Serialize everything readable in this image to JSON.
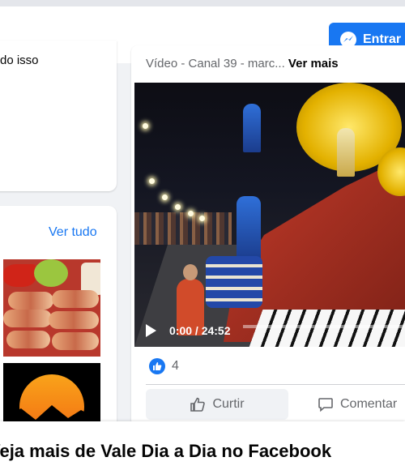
{
  "header": {
    "enter_label": "Entrar",
    "enter_icon": "messenger-icon",
    "accent": "#1877f2"
  },
  "left_top": {
    "snippet": "do isso"
  },
  "photos": {
    "see_all": "Ver tudo"
  },
  "post": {
    "caption": "Vídeo - Canal 39 - marc...",
    "see_more": "Ver mais",
    "video": {
      "time": "0:00 / 24:52",
      "progress": 0
    },
    "like_count": "4",
    "like_label": "Curtir",
    "comment_label": "Comentar"
  },
  "banner": {
    "text": "Veja mais de Vale Dia a Dia no Facebook"
  }
}
